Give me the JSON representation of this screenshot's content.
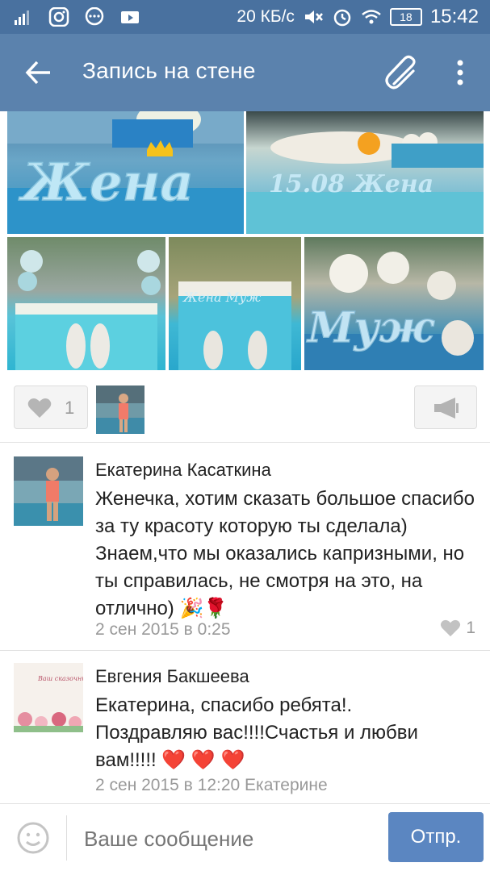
{
  "status_bar": {
    "network_speed": "20 КБ/с",
    "battery": "18",
    "time": "15:42"
  },
  "app_bar": {
    "title": "Запись на стене"
  },
  "post": {
    "photos": [
      {
        "caption_art": "Жена"
      },
      {
        "caption_art": "15.08 Жена"
      },
      {
        "caption_art": ""
      },
      {
        "caption_art": "Жена Муж"
      },
      {
        "caption_art": "Муж"
      }
    ],
    "likes_count": "1"
  },
  "comments": [
    {
      "author": "Екатерина Касаткина",
      "text_lines": [
        "Женечка, хотим сказать большое спасибо",
        "за ту красоту которую ты сделала)",
        "Знаем,что мы оказались капризными, но",
        "ты справилась, не смотря на это, на",
        "отлично) 🎉🌹"
      ],
      "date": "2 сен 2015 в 0:25",
      "likes": "1"
    },
    {
      "author": "Евгения Бакшеева",
      "avatar_text": "Ваш сказочный декоратор",
      "text_lines": [
        "Екатерина, спасибо ребята!.",
        "Поздравляю вас!!!!Счастья и любви",
        "вам!!!!! ❤️ ❤️ ❤️"
      ],
      "date": "2 сен 2015 в 12:20 Екатерине"
    }
  ],
  "composer": {
    "placeholder": "Ваше сообщение",
    "send_label": "Отпр."
  },
  "colors": {
    "status_bar": "#49719f",
    "app_bar": "#5b82ad",
    "send_button": "#5b86c1"
  }
}
